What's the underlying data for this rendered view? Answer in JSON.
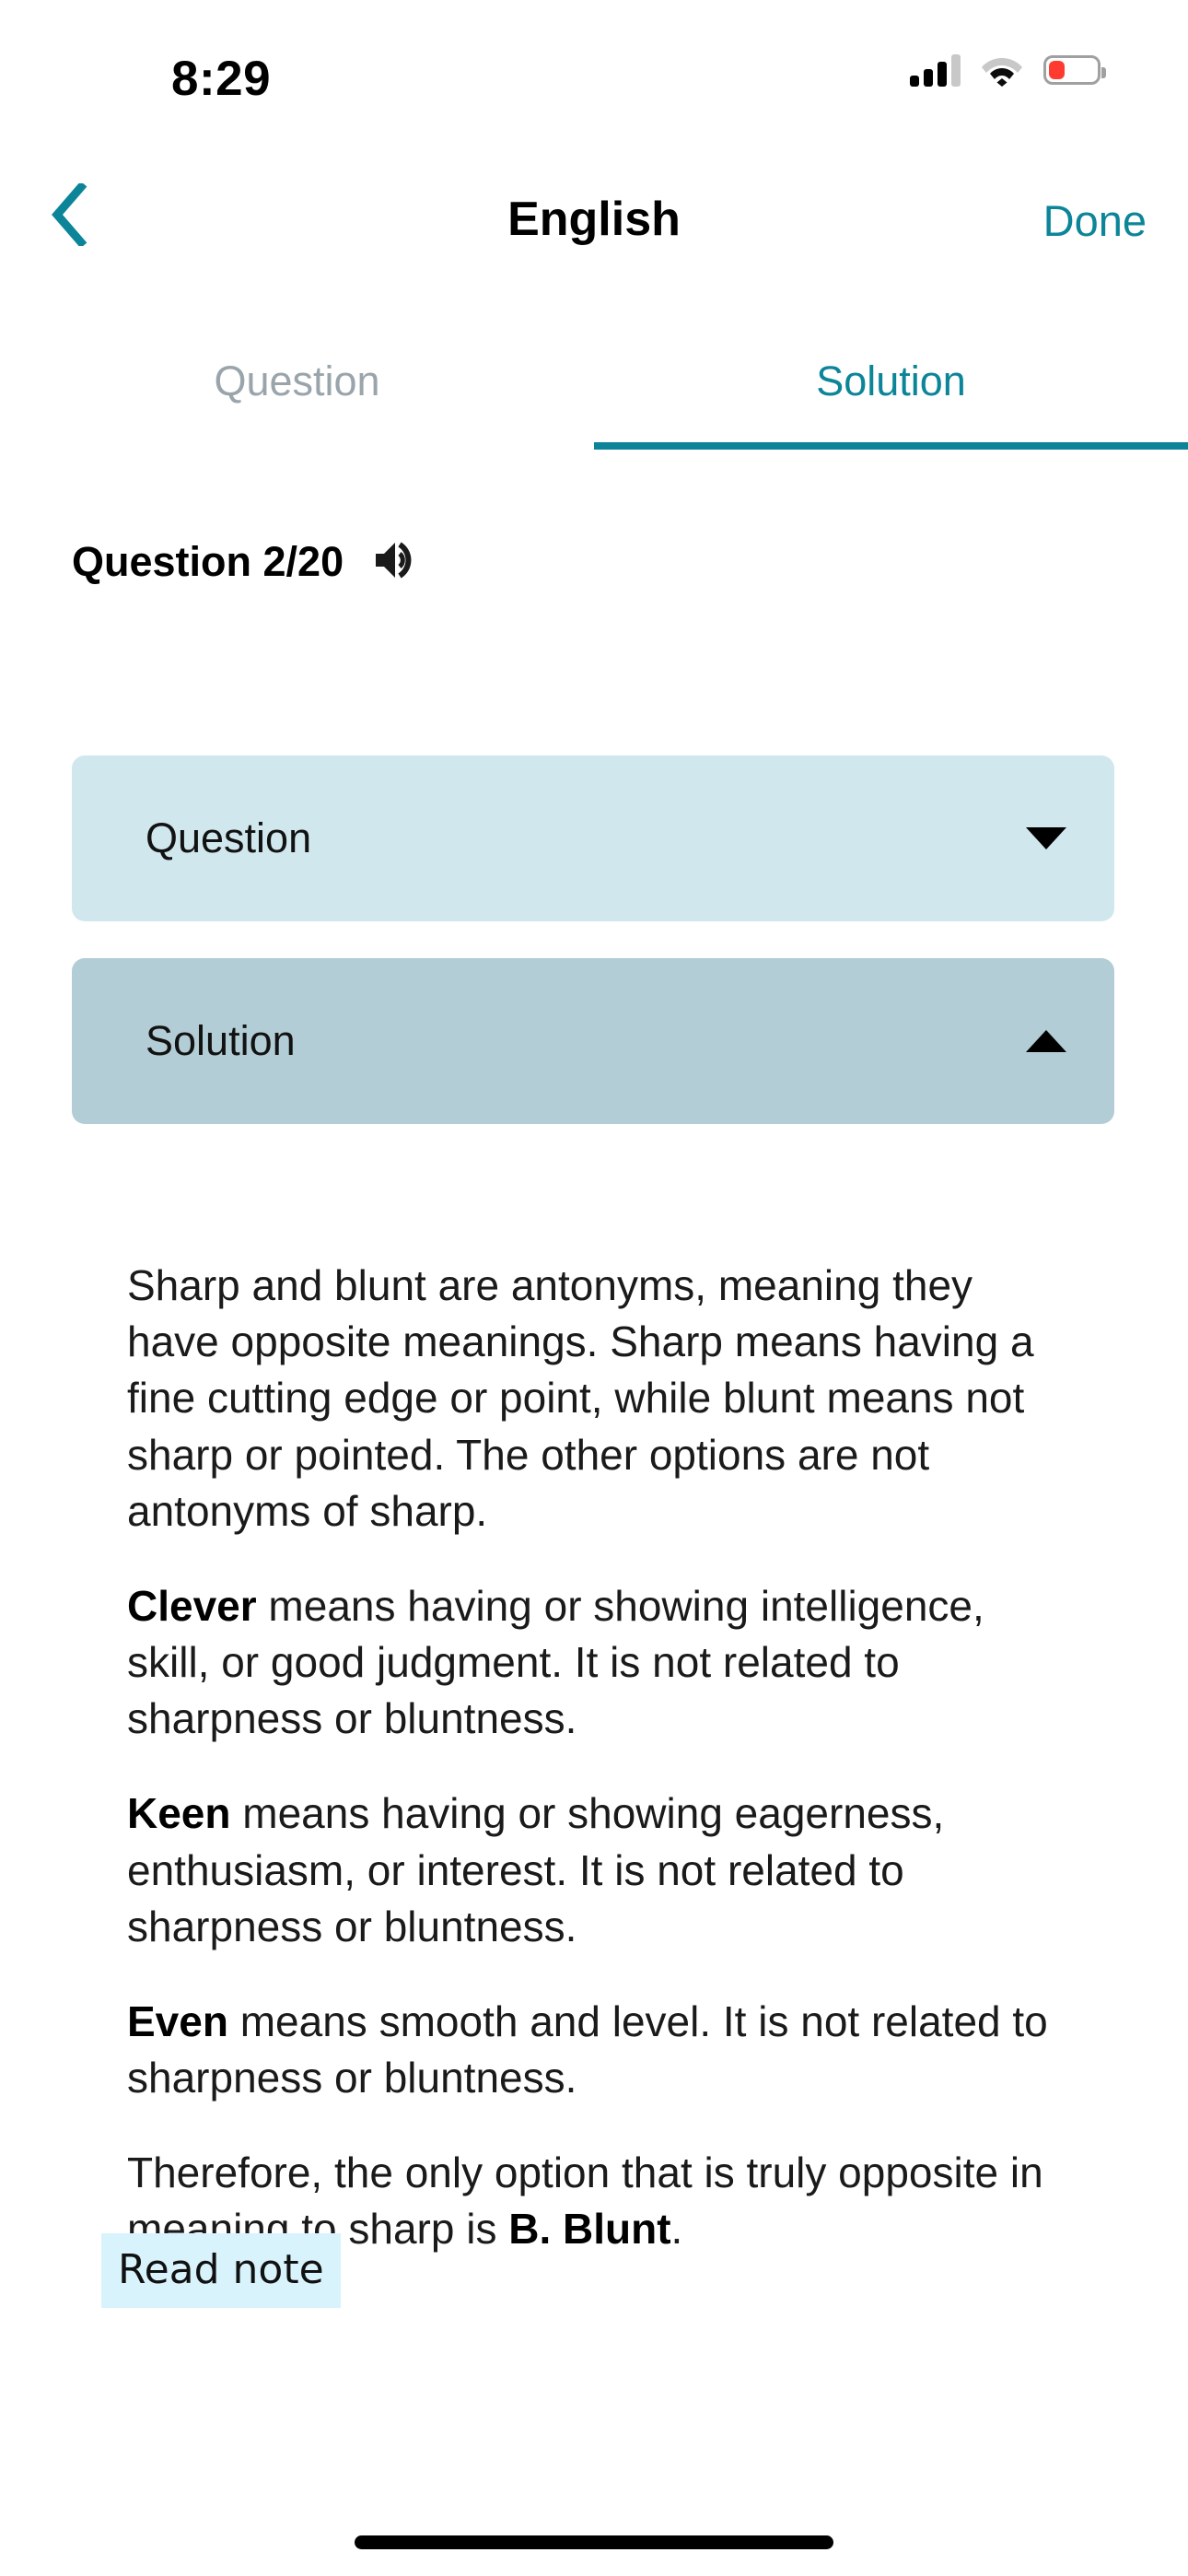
{
  "status_bar": {
    "time": "8:29",
    "cellular_icon": "cellular-bars-icon",
    "wifi_icon": "wifi-icon",
    "battery_icon": "battery-low-icon",
    "battery_color": "#ff3b30"
  },
  "nav": {
    "back_icon": "chevron-left-icon",
    "title": "English",
    "done_label": "Done",
    "accent_color": "#0c8599"
  },
  "tabs": {
    "items": [
      {
        "label": "Question",
        "active": false
      },
      {
        "label": "Solution",
        "active": true
      }
    ],
    "active_index": 1,
    "active_color": "#0c8599",
    "inactive_color": "#9aa5ab",
    "underline_color": "#0b8499"
  },
  "question_meta": {
    "counter": "Question 2/20",
    "current": 2,
    "total": 20,
    "audio_icon": "speaker-volume-icon"
  },
  "accordions": [
    {
      "label": "Question",
      "expanded": false,
      "caret_icon": "chevron-down-icon",
      "background": "#d0e7ee"
    },
    {
      "label": "Solution",
      "expanded": true,
      "caret_icon": "chevron-up-icon",
      "background": "#b2cdd5"
    }
  ],
  "solution": {
    "paragraphs": [
      {
        "lead": "",
        "text": "Sharp and blunt are antonyms, meaning they have opposite meanings. Sharp means having a fine cutting edge or point, while blunt means not sharp or pointed. The other options are not antonyms of sharp."
      },
      {
        "lead": "Clever",
        "text": " means having or showing intelligence, skill, or good judgment. It is not related to sharpness or bluntness."
      },
      {
        "lead": "Keen",
        "text": " means having or showing eagerness, enthusiasm, or interest. It is not related to sharpness or bluntness."
      },
      {
        "lead": "Even",
        "text": " means smooth and level. It is not related to sharpness or bluntness."
      }
    ],
    "conclusion_prefix": "Therefore, the only option that is truly opposite in meaning to sharp is ",
    "conclusion_answer": "B. Blunt",
    "conclusion_suffix": ".",
    "read_note_label": "Read note",
    "read_note_background": "#d8f3fb"
  },
  "home_indicator": "home-indicator"
}
